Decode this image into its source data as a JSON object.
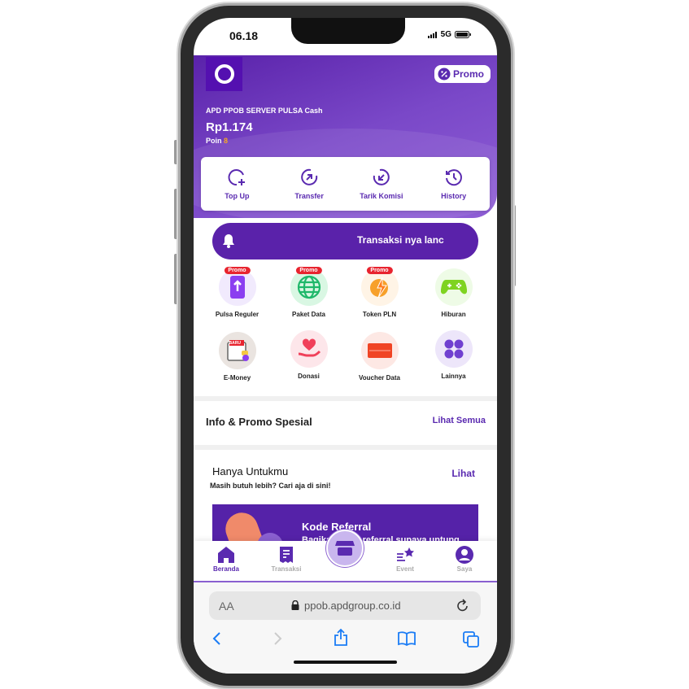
{
  "status_bar": {
    "time": "06.18",
    "network": "5G"
  },
  "header": {
    "account_name": "APD PPOB SERVER PULSA Cash",
    "balance": "Rp1.174",
    "points_label": "Poin",
    "points_value": "8",
    "promo_label": "Promo"
  },
  "actions": [
    {
      "label": "Top Up",
      "icon": "add-circle-icon"
    },
    {
      "label": "Transfer",
      "icon": "arrow-up-right-circle-icon"
    },
    {
      "label": "Tarik Komisi",
      "icon": "arrow-down-left-circle-icon"
    },
    {
      "label": "History",
      "icon": "history-icon"
    }
  ],
  "notification": {
    "text": "Transaksi nya lanc"
  },
  "services": [
    {
      "label": "Pulsa Reguler",
      "badge": "Promo",
      "icon": "phone-upload-icon",
      "bg": "#f1eafd"
    },
    {
      "label": "Paket Data",
      "badge": "Promo",
      "icon": "globe-icon",
      "bg": "#d9f7e3"
    },
    {
      "label": "Token PLN",
      "badge": "Promo",
      "icon": "lightning-icon",
      "bg": "#fff4e6"
    },
    {
      "label": "Hiburan",
      "icon": "gamepad-icon",
      "bg": "#eefbe6"
    },
    {
      "label": "E-Money",
      "badge_inner": "BARU",
      "icon": "wallet-icon",
      "bg": "#eae4e0"
    },
    {
      "label": "Donasi",
      "icon": "heart-hand-icon",
      "bg": "#fde6ea"
    },
    {
      "label": "Voucher Data",
      "icon": "voucher-icon",
      "bg": "#fde8e4"
    },
    {
      "label": "Lainnya",
      "icon": "grid-icon",
      "bg": "#ede6fa"
    }
  ],
  "info_promo": {
    "title": "Info & Promo Spesial",
    "link": "Lihat Semua"
  },
  "for_you": {
    "title": "Hanya Untukmu",
    "subtitle": "Masih butuh lebih? Cari aja di sini!",
    "link": "Lihat",
    "banner_title": "Kode Referral",
    "banner_text": "Bagikan kode referral supaya untung"
  },
  "bottom_nav": [
    {
      "label": "Beranda",
      "active": true
    },
    {
      "label": "Transaksi"
    },
    {
      "label": ""
    },
    {
      "label": "Event"
    },
    {
      "label": "Saya"
    }
  ],
  "browser": {
    "text_size": "AA",
    "url": "ppob.apdgroup.co.id"
  },
  "colors": {
    "primary": "#5a22aa",
    "promo_badge": "#e8242f",
    "points": "#f5a623",
    "safari_blue": "#1a7cf5"
  }
}
